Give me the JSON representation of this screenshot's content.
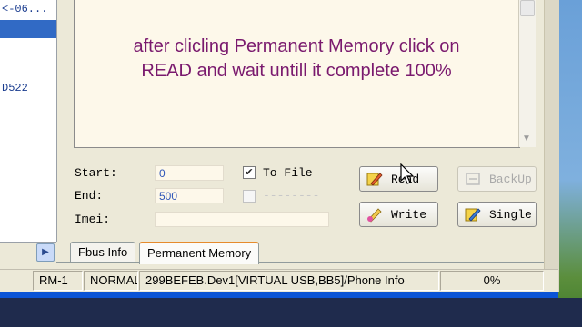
{
  "tree": {
    "item_top": "<-06...",
    "item_bottom": "D522"
  },
  "message": {
    "line1": "after clicling Permanent Memory click on",
    "line2": "READ and wait untill it complete 100%"
  },
  "form": {
    "start_label": "Start:",
    "start_value": "0",
    "end_label": "End:",
    "end_value": "500",
    "imei_label": "Imei:",
    "imei_value": "",
    "to_file_label": "To File",
    "to_file_checked": true,
    "second_check_label": "--------",
    "second_check_checked": false
  },
  "buttons": {
    "read": "Read",
    "backup": "BackUp",
    "write": "Write",
    "single": "Single"
  },
  "tabs": [
    {
      "label": "Fbus Info",
      "active": false
    },
    {
      "label": "Permanent Memory",
      "active": true
    }
  ],
  "status_bar": {
    "model": "RM-1",
    "mode": "NORMAL",
    "device": "299BEFEB.Dev1[VIRTUAL USB,BB5]/Phone Info",
    "progress": "0%"
  },
  "colors": {
    "message_text": "#7a1a6e",
    "field_value": "#2e56b8",
    "tab_highlight": "#e68b2c",
    "selection": "#316ac5"
  }
}
